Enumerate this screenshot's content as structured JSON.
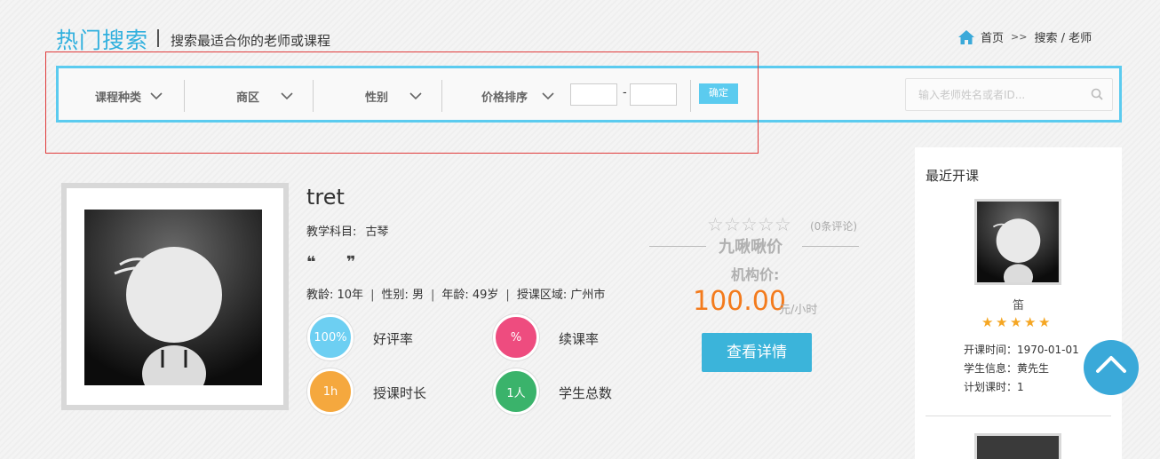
{
  "header": {
    "title": "热门搜索",
    "subtitle": "搜索最适合你的老师或课程",
    "breadcrumb": {
      "home": "首页",
      "separator": ">>",
      "current": "搜索 / 老师"
    }
  },
  "filters": {
    "course_type": "课程种类",
    "district": "商区",
    "gender": "性别",
    "price_sort": "价格排序",
    "price_min": "",
    "price_max": "",
    "price_dash": "-",
    "confirm": "确定",
    "search_placeholder": "输入老师姓名或者ID..."
  },
  "teacher": {
    "name": "tret",
    "subject_label": "教学科目:",
    "subject": "古琴",
    "quote": "❝ ❞",
    "experience": "教龄: 10年",
    "gender": "性别: 男",
    "age": "年龄: 49岁",
    "area": "授课区域: 广州市",
    "info_sep": "|",
    "stats": [
      {
        "value": "100%",
        "label": "好评率",
        "color": "#6dcff2"
      },
      {
        "value": "%",
        "label": "续课率",
        "color": "#ee4c7f"
      },
      {
        "value": "1h",
        "label": "授课时长",
        "color": "#f5a83e"
      },
      {
        "value": "1人",
        "label": "学生总数",
        "color": "#3ab36b"
      }
    ],
    "rating": 0,
    "review_count": "(0条评论)",
    "brand": "九啾啾价",
    "inst_price_label": "机构价:",
    "price": "100.00",
    "price_unit": "元/小时",
    "detail_button": "查看详情"
  },
  "sidebar": {
    "title": "最近开课",
    "course": {
      "name": "笛",
      "rating": 5,
      "open_time": "开课时间：1970-01-01",
      "student": "学生信息：黄先生",
      "planned_hours": "计划课时：1"
    }
  },
  "colors": {
    "accent": "#31b0de",
    "filter_border": "#5bcbef",
    "price": "#f37b1d",
    "star_filled": "#f5a623",
    "back_top": "#3aa9d9"
  },
  "icons": [
    "home-icon",
    "chevron-down-icon",
    "search-icon",
    "star-icon",
    "arrow-up-icon"
  ]
}
